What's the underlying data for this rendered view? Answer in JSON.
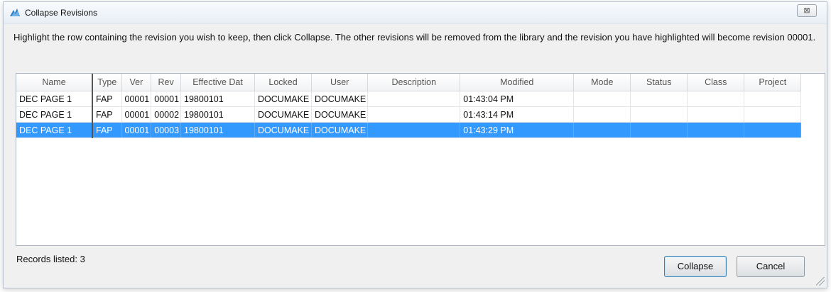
{
  "window": {
    "title": "Collapse Revisions",
    "close_glyph": "⊠",
    "icon": "app-icon"
  },
  "instructions": "Highlight the row containing the revision you wish to keep, then click Collapse.  The other revisions will be removed from the library and the revision you have highlighted will become revision 00001.",
  "table": {
    "columns": [
      "Name",
      "Type",
      "Ver",
      "Rev",
      "Effective Dat",
      "Locked",
      "User",
      "Description",
      "Modified",
      "Mode",
      "Status",
      "Class",
      "Project"
    ],
    "rows": [
      {
        "name": "DEC PAGE 1",
        "type": "FAP",
        "ver": "00001",
        "rev": "00001",
        "effective": "19800101",
        "locked": "DOCUMAKE",
        "user": "DOCUMAKE",
        "description": "",
        "modified": "01:43:04 PM",
        "mode": "",
        "status": "",
        "class": "",
        "project": ""
      },
      {
        "name": "DEC PAGE 1",
        "type": "FAP",
        "ver": "00001",
        "rev": "00002",
        "effective": "19800101",
        "locked": "DOCUMAKE",
        "user": "DOCUMAKE",
        "description": "",
        "modified": "01:43:14 PM",
        "mode": "",
        "status": "",
        "class": "",
        "project": ""
      },
      {
        "name": "DEC PAGE 1",
        "type": "FAP",
        "ver": "00001",
        "rev": "00003",
        "effective": "19800101",
        "locked": "DOCUMAKE",
        "user": "DOCUMAKE",
        "description": "",
        "modified": "01:43:29 PM",
        "mode": "",
        "status": "",
        "class": "",
        "project": ""
      }
    ],
    "selected_row": 2,
    "selection_color": "#3399ff"
  },
  "footer": {
    "records_listed": "Records listed: 3",
    "collapse_label": "Collapse",
    "cancel_label": "Cancel"
  }
}
